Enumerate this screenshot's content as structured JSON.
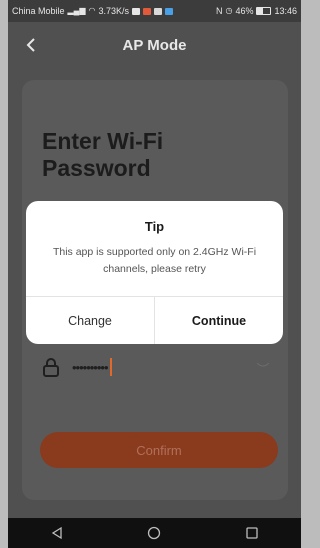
{
  "status_bar": {
    "carrier": "China Mobile",
    "speed": "3.73K/s",
    "nfc": "N",
    "battery_pct": "46%",
    "battery_level": 0.46,
    "time": "13:46"
  },
  "header": {
    "title": "AP Mode",
    "back_icon": "chevron-left-icon"
  },
  "form": {
    "heading": "Enter Wi-Fi Password",
    "password_value": "••••••••••",
    "confirm_label": "Confirm"
  },
  "dialog": {
    "title": "Tip",
    "message": "This app is supported only on 2.4GHz Wi-Fi channels, please retry",
    "change_label": "Change",
    "continue_label": "Continue"
  },
  "colors": {
    "accent": "#8a3a1d",
    "overlay": "#505050",
    "dialog_bg": "#ffffff"
  }
}
